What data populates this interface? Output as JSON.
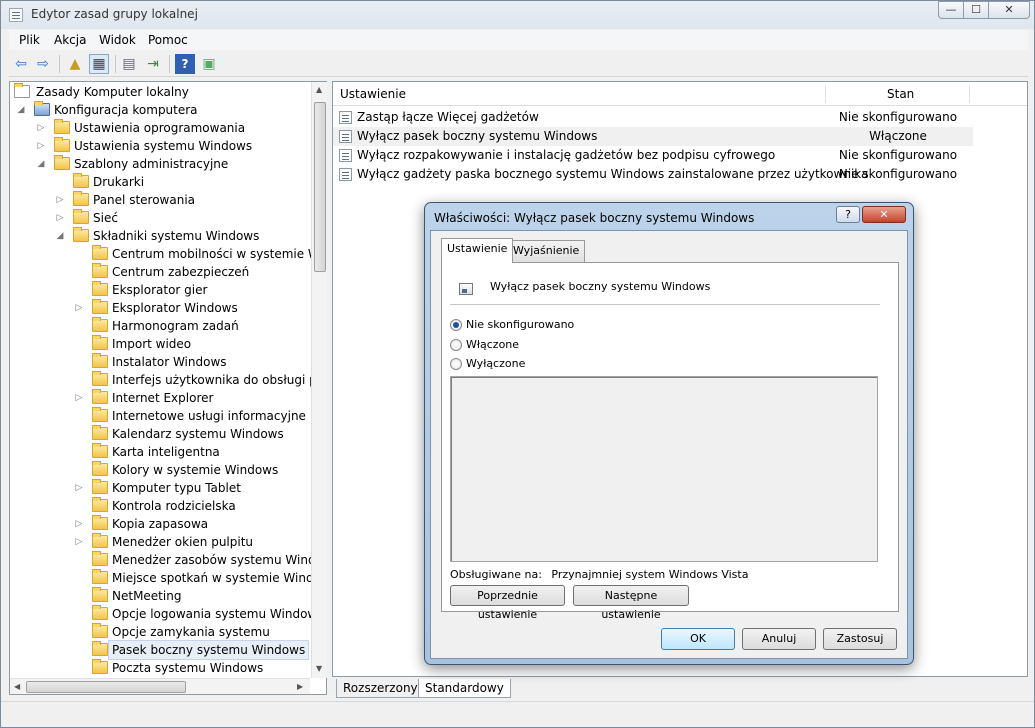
{
  "window": {
    "title": "Edytor zasad grupy lokalnej",
    "controls": {
      "minimize": "—",
      "maximize": "☐",
      "close": "✕"
    }
  },
  "menu": [
    "Plik",
    "Akcja",
    "Widok",
    "Pomoc"
  ],
  "toolbar": {
    "icons": [
      "back-arrow-icon",
      "forward-arrow-icon",
      "up-folder-icon",
      "show-hide-tree-icon",
      "properties-icon",
      "export-list-icon",
      "help-icon",
      "extended-view-icon"
    ]
  },
  "tree": {
    "root": "Zasady Komputer lokalny",
    "computer_config": "Konfiguracja komputera",
    "level1": [
      "Ustawienia oprogramowania",
      "Ustawienia systemu Windows",
      "Szablony administracyjne"
    ],
    "level2": [
      "Drukarki",
      "Panel sterowania",
      "Sieć",
      "Składniki systemu Windows"
    ],
    "components": [
      "Centrum mobilności w systemie Windows",
      "Centrum zabezpieczeń",
      "Eksplorator gier",
      "Eksplorator Windows",
      "Harmonogram zadań",
      "Import wideo",
      "Instalator Windows",
      "Interfejs użytkownika do obsługi pośw",
      "Internet Explorer",
      "Internetowe usługi informacyjne",
      "Kalendarz systemu Windows",
      "Karta inteligentna",
      "Kolory w systemie Windows",
      "Komputer typu Tablet",
      "Kontrola rodzicielska",
      "Kopia zapasowa",
      "Menedżer okien pulpitu",
      "Menedżer zasobów systemu Windows",
      "Miejsce spotkań w systemie Windows",
      "NetMeeting",
      "Opcje logowania systemu Windows",
      "Opcje zamykania systemu",
      "Pasek boczny systemu Windows",
      "Poczta systemu Windows"
    ],
    "selected": "Pasek boczny systemu Windows"
  },
  "list": {
    "headers": {
      "setting": "Ustawienie",
      "state": "Stan"
    },
    "rows": [
      {
        "name": "Zastąp łącze Więcej gadżetów",
        "state": "Nie skonfigurowano"
      },
      {
        "name": "Wyłącz pasek boczny systemu Windows",
        "state": "Włączone"
      },
      {
        "name": "Wyłącz rozpakowywanie i instalację gadżetów bez podpisu cyfrowego",
        "state": "Nie skonfigurowano"
      },
      {
        "name": "Wyłącz gadżety paska bocznego systemu Windows zainstalowane przez użytkownika",
        "state": "Nie skonfigurowano"
      }
    ],
    "highlighted_row": 1
  },
  "bottom_tabs": [
    "Rozszerzony",
    "Standardowy"
  ],
  "dialog": {
    "title": "Właściwości: Wyłącz pasek boczny systemu Windows",
    "help_label": "?",
    "close_label": "✕",
    "tabs": [
      "Ustawienie",
      "Wyjaśnienie"
    ],
    "active_tab": "Ustawienie",
    "policy_name": "Wyłącz pasek boczny systemu Windows",
    "options": [
      "Nie skonfigurowano",
      "Włączone",
      "Wyłączone"
    ],
    "selected_option": "Nie skonfigurowano",
    "supported_label": "Obsługiwane na:",
    "supported_value": "Przynajmniej system Windows Vista",
    "prev_button": "Poprzednie ustawienie",
    "next_button": "Następne ustawienie",
    "ok": "OK",
    "cancel": "Anuluj",
    "apply": "Zastosuj"
  }
}
